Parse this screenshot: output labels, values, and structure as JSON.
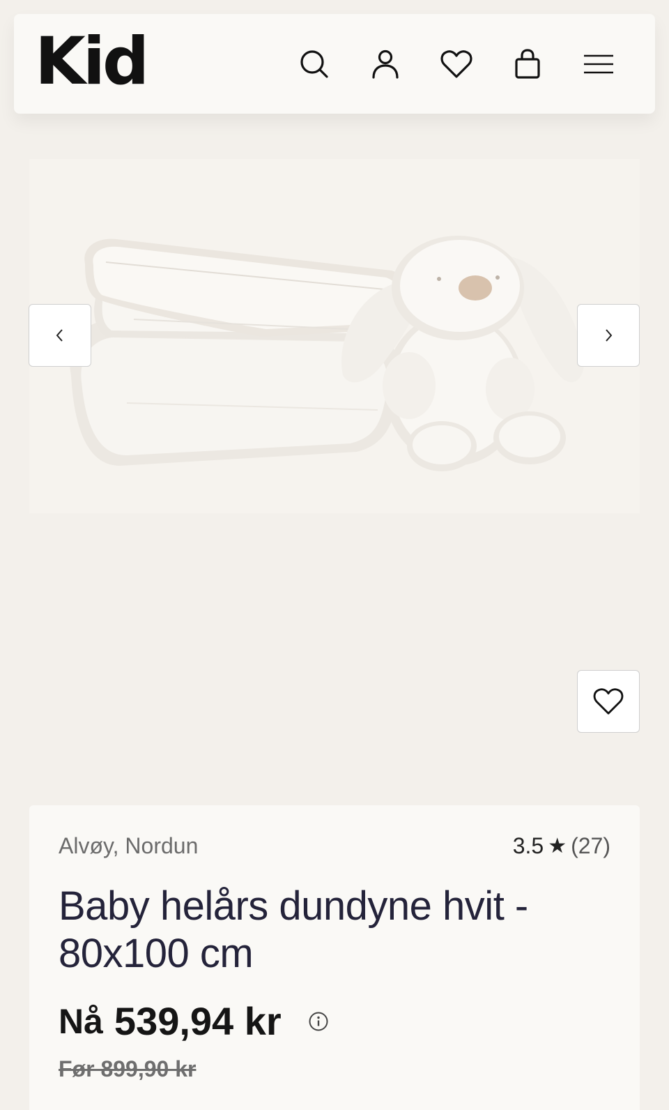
{
  "header": {
    "logo": "Kid",
    "icons": [
      "search-icon",
      "user-icon",
      "heart-icon",
      "bag-icon",
      "menu-icon"
    ]
  },
  "gallery": {
    "image_alt": "folded white duvet with plush bunny",
    "prev_icon": "chevron-left-icon",
    "next_icon": "chevron-right-icon"
  },
  "favorite": {
    "icon": "heart-icon"
  },
  "product": {
    "brand": "Alvøy, Nordun",
    "rating_score": "3.5",
    "rating_star": "★",
    "rating_count": "(27)",
    "title": "Baby helårs dundyne hvit - 80x100 cm",
    "price_prefix": "Nå",
    "price": "539,94 kr",
    "old_price": "Før 899,90 kr"
  },
  "colors": {
    "page_bg": "#f3f0eb",
    "card_bg": "#faf9f6",
    "text_dark": "#24233a"
  }
}
